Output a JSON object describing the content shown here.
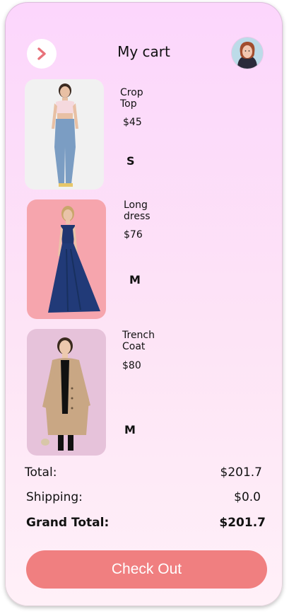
{
  "header": {
    "title": "My cart",
    "back_icon": "chevron-right-icon",
    "avatar_icon": "user-avatar"
  },
  "items": [
    {
      "name": "Crop Top",
      "price": "$45",
      "size": "S",
      "bg": "#f1f1f1"
    },
    {
      "name": "Long dress",
      "price": "$76",
      "size": "M",
      "bg": "#f6a5ad"
    },
    {
      "name": "Trench Coat",
      "price": "$80",
      "size": "M",
      "bg": "#e6c2da"
    }
  ],
  "summary": {
    "total_label": "Total:",
    "total_value": "$201.7",
    "shipping_label": "Shipping:",
    "shipping_value": "$0.0",
    "grand_total_label": "Grand Total:",
    "grand_total_value": "$201.7"
  },
  "checkout_label": "Check Out",
  "colors": {
    "accent": "#f07f80",
    "chevron": "#e8727a",
    "background_top": "#fcd6fc",
    "background_bottom": "#fff0f8"
  }
}
